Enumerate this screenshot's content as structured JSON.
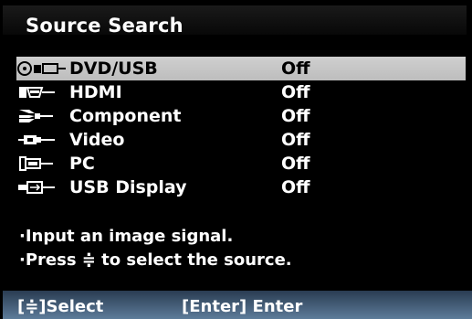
{
  "title": "Source Search",
  "sources": [
    {
      "icon": "dvd-usb-icon",
      "label": "DVD/USB",
      "value": "Off",
      "selected": true
    },
    {
      "icon": "hdmi-icon",
      "label": "HDMI",
      "value": "Off"
    },
    {
      "icon": "component-icon",
      "label": "Component",
      "value": "Off"
    },
    {
      "icon": "video-icon",
      "label": "Video",
      "value": "Off"
    },
    {
      "icon": "pc-icon",
      "label": "PC",
      "value": "Off"
    },
    {
      "icon": "usb-display-icon",
      "label": "USB Display",
      "value": "Off"
    }
  ],
  "messages": {
    "line1": "·Input an image signal.",
    "line2": "·Press  ≑ to select the source."
  },
  "footer": {
    "select_hint": "[≑]Select",
    "enter_hint": "[Enter] Enter"
  },
  "colors": {
    "background": "#000000",
    "selected_row": "#c8c8c8",
    "footer": "#4a6682"
  }
}
